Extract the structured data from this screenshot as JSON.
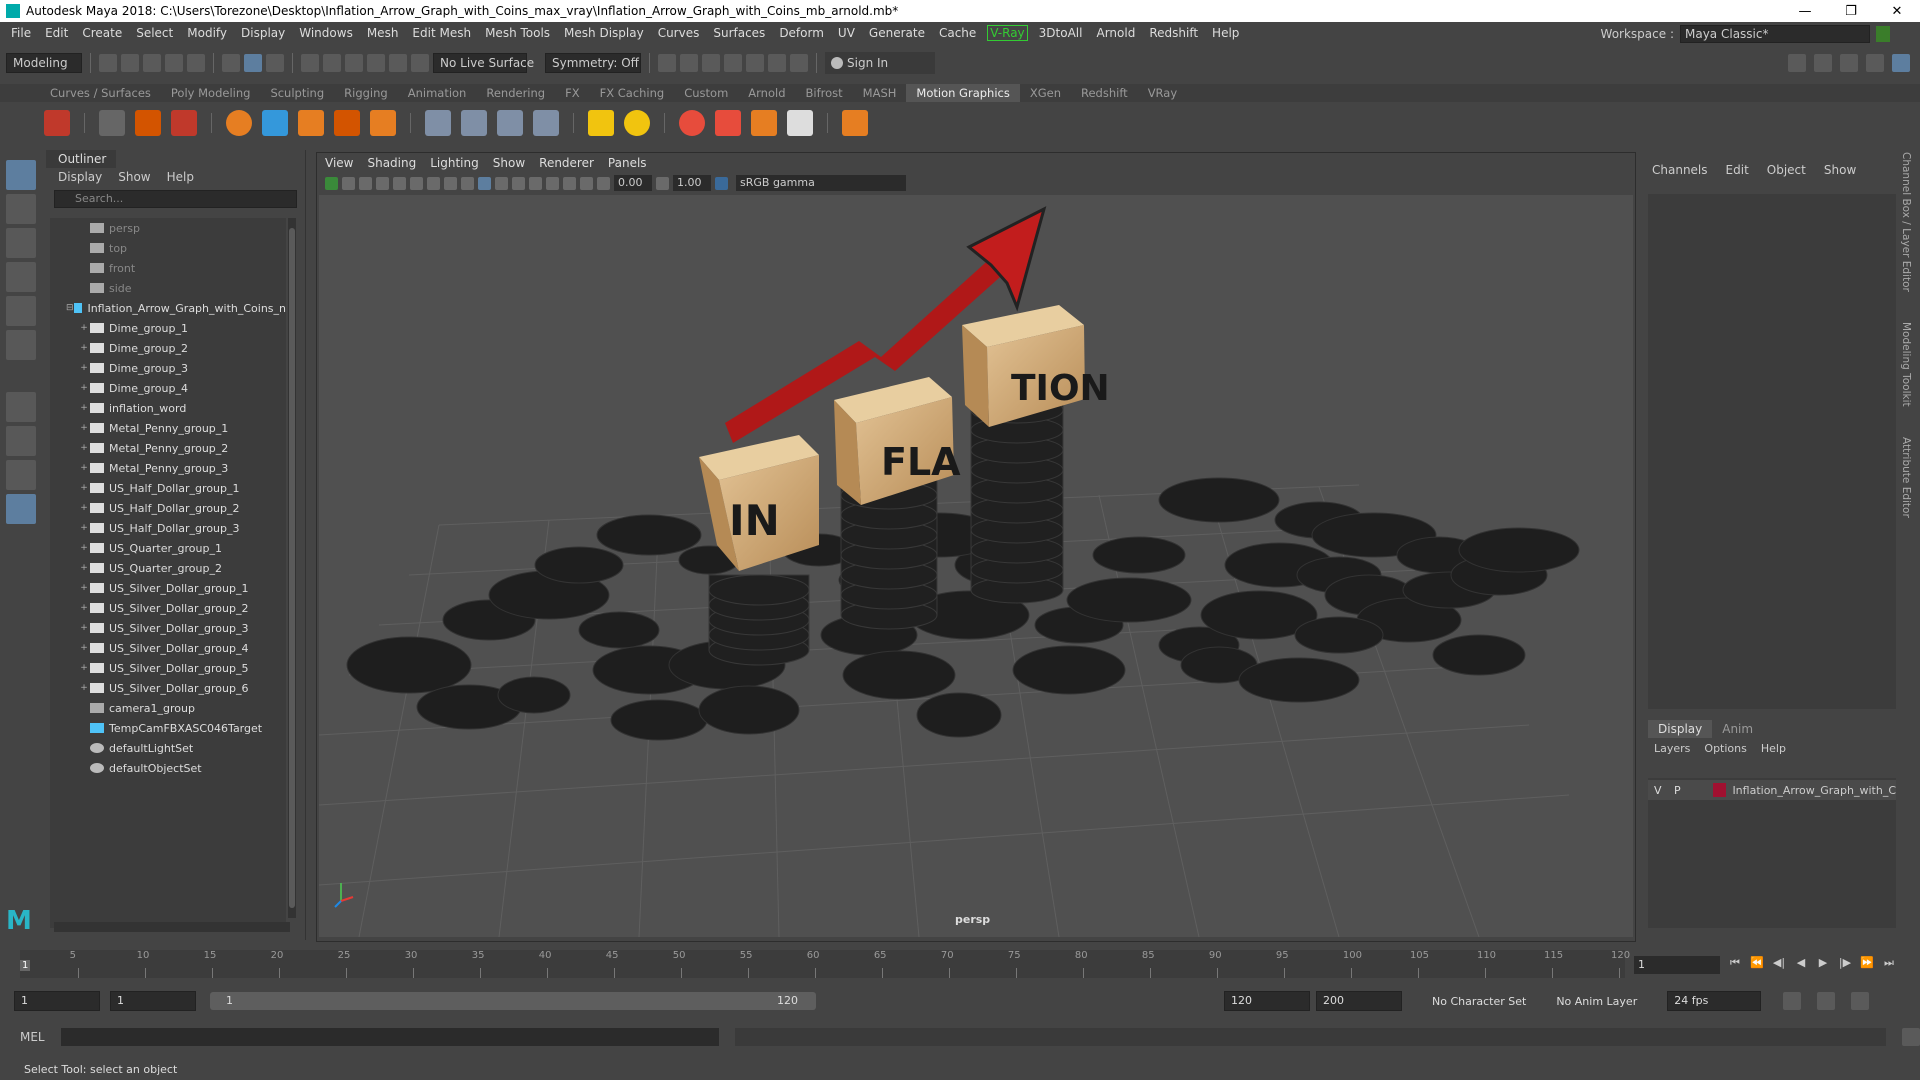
{
  "window": {
    "title": "Autodesk Maya 2018: C:\\Users\\Torezone\\Desktop\\Inflation_Arrow_Graph_with_Coins_max_vray\\Inflation_Arrow_Graph_with_Coins_mb_arnold.mb*",
    "minimize": "—",
    "maximize": "❐",
    "close": "✕"
  },
  "menubar": [
    "File",
    "Edit",
    "Create",
    "Select",
    "Modify",
    "Display",
    "Windows",
    "Mesh",
    "Edit Mesh",
    "Mesh Tools",
    "Mesh Display",
    "Curves",
    "Surfaces",
    "Deform",
    "UV",
    "Generate",
    "Cache",
    "V-Ray",
    "3DtoAll",
    "Arnold",
    "Redshift",
    "Help"
  ],
  "workspace": {
    "label": "Workspace :",
    "value": "Maya Classic*"
  },
  "statusline": {
    "mode": "Modeling",
    "live_surface": "No Live Surface",
    "symmetry": "Symmetry: Off",
    "sign_in": "Sign In"
  },
  "shelf_tabs": [
    "Curves / Surfaces",
    "Poly Modeling",
    "Sculpting",
    "Rigging",
    "Animation",
    "Rendering",
    "FX",
    "FX Caching",
    "Custom",
    "Arnold",
    "Bifrost",
    "MASH",
    "Motion Graphics",
    "XGen",
    "Redshift",
    "VRay"
  ],
  "shelf_active": "Motion Graphics",
  "outliner": {
    "title": "Outliner",
    "menu": [
      "Display",
      "Show",
      "Help"
    ],
    "search_placeholder": "Search...",
    "items": [
      {
        "label": "persp",
        "depth": 1,
        "dim": true,
        "icon": "camera-icon"
      },
      {
        "label": "top",
        "depth": 1,
        "dim": true,
        "icon": "camera-icon"
      },
      {
        "label": "front",
        "depth": 1,
        "dim": true,
        "icon": "camera-icon"
      },
      {
        "label": "side",
        "depth": 1,
        "dim": true,
        "icon": "camera-icon"
      },
      {
        "label": "Inflation_Arrow_Graph_with_Coins_n",
        "depth": 0,
        "expanded": true,
        "icon": "group-icon"
      },
      {
        "label": "Dime_group_1",
        "depth": 2,
        "icon": "mesh-icon"
      },
      {
        "label": "Dime_group_2",
        "depth": 2,
        "icon": "mesh-icon"
      },
      {
        "label": "Dime_group_3",
        "depth": 2,
        "icon": "mesh-icon"
      },
      {
        "label": "Dime_group_4",
        "depth": 2,
        "icon": "mesh-icon"
      },
      {
        "label": "inflation_word",
        "depth": 2,
        "icon": "mesh-icon"
      },
      {
        "label": "Metal_Penny_group_1",
        "depth": 2,
        "icon": "mesh-icon"
      },
      {
        "label": "Metal_Penny_group_2",
        "depth": 2,
        "icon": "mesh-icon"
      },
      {
        "label": "Metal_Penny_group_3",
        "depth": 2,
        "icon": "mesh-icon"
      },
      {
        "label": "US_Half_Dollar_group_1",
        "depth": 2,
        "icon": "mesh-icon"
      },
      {
        "label": "US_Half_Dollar_group_2",
        "depth": 2,
        "icon": "mesh-icon"
      },
      {
        "label": "US_Half_Dollar_group_3",
        "depth": 2,
        "icon": "mesh-icon"
      },
      {
        "label": "US_Quarter_group_1",
        "depth": 2,
        "icon": "mesh-icon"
      },
      {
        "label": "US_Quarter_group_2",
        "depth": 2,
        "icon": "mesh-icon"
      },
      {
        "label": "US_Silver_Dollar_group_1",
        "depth": 2,
        "icon": "mesh-icon"
      },
      {
        "label": "US_Silver_Dollar_group_2",
        "depth": 2,
        "icon": "mesh-icon"
      },
      {
        "label": "US_Silver_Dollar_group_3",
        "depth": 2,
        "icon": "mesh-icon"
      },
      {
        "label": "US_Silver_Dollar_group_4",
        "depth": 2,
        "icon": "mesh-icon"
      },
      {
        "label": "US_Silver_Dollar_group_5",
        "depth": 2,
        "icon": "mesh-icon"
      },
      {
        "label": "US_Silver_Dollar_group_6",
        "depth": 2,
        "icon": "mesh-icon"
      },
      {
        "label": "camera1_group",
        "depth": 1,
        "icon": "camera-group-icon"
      },
      {
        "label": "TempCamFBXASC046Target",
        "depth": 1,
        "icon": "locator-icon"
      },
      {
        "label": "defaultLightSet",
        "depth": 1,
        "icon": "set-icon"
      },
      {
        "label": "defaultObjectSet",
        "depth": 1,
        "icon": "set-icon"
      }
    ]
  },
  "viewport": {
    "menu": [
      "View",
      "Shading",
      "Lighting",
      "Show",
      "Renderer",
      "Panels"
    ],
    "near_value": "0.00",
    "far_value": "1.00",
    "color_space": "sRGB gamma",
    "camera_label": "persp",
    "scene_text": [
      "IN",
      "FLA",
      "TION"
    ]
  },
  "channelbox": {
    "menu": [
      "Channels",
      "Edit",
      "Object",
      "Show"
    ],
    "layer_tabs": [
      "Display",
      "Anim"
    ],
    "layer_menu": [
      "Layers",
      "Options",
      "Help"
    ],
    "layer": {
      "v": "V",
      "p": "P",
      "name": "Inflation_Arrow_Graph_with_C",
      "color": "#a01030"
    },
    "side_tabs": [
      "Channel Box / Layer Editor",
      "Modeling Toolkit",
      "Attribute Editor"
    ]
  },
  "timeslider": {
    "ticks": [
      "5",
      "10",
      "15",
      "20",
      "25",
      "30",
      "35",
      "40",
      "45",
      "50",
      "55",
      "60",
      "65",
      "70",
      "75",
      "80",
      "85",
      "90",
      "95",
      "100",
      "105",
      "110",
      "115",
      "120"
    ],
    "current_frame_marker": "1",
    "current_frame": "1"
  },
  "range": {
    "start": "1",
    "playback_start": "1",
    "bar_start": "1",
    "bar_end": "120",
    "playback_end": "120",
    "end": "200",
    "character_set": "No Character Set",
    "anim_layer": "No Anim Layer",
    "fps": "24 fps"
  },
  "command": {
    "label": "MEL"
  },
  "help": {
    "text": "Select Tool: select an object"
  }
}
